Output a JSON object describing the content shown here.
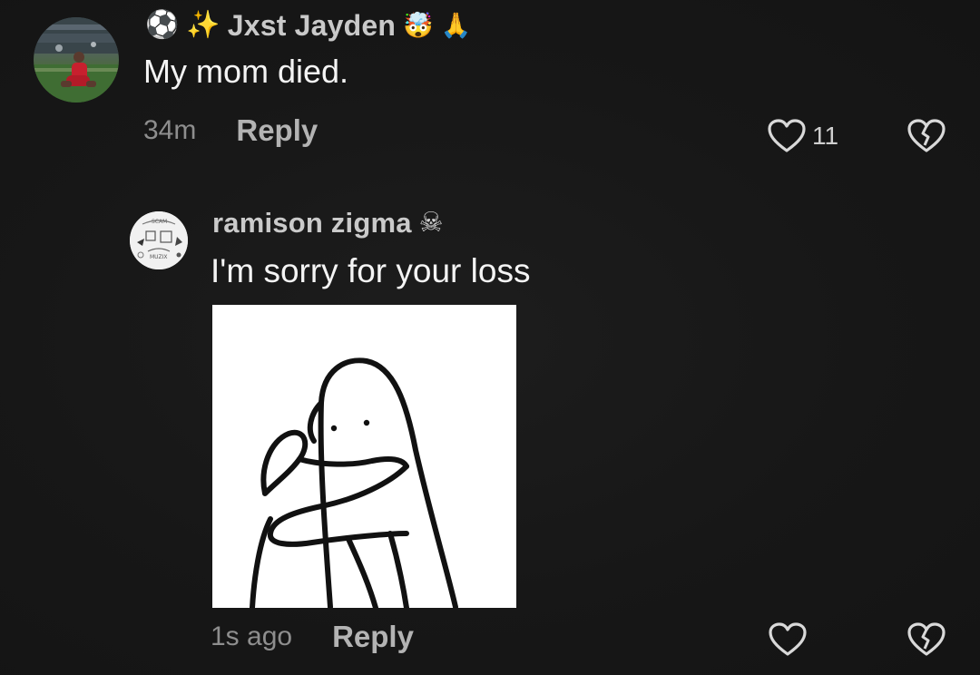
{
  "comments": [
    {
      "username": "Jxst Jayden",
      "name_prefix_emojis": [
        "soccer-ball",
        "dizzy-star"
      ],
      "name_suffix_emojis": [
        "exploding-head",
        "folded-hands"
      ],
      "text": "My mom died.",
      "time": "34m",
      "reply_label": "Reply",
      "like_count": "11",
      "avatar": "soccer-player-photo"
    },
    {
      "username": "ramison zigma",
      "name_suffix_emojis": [
        "skull-and-crossbones"
      ],
      "text": "I'm sorry for your loss",
      "time": "1s ago",
      "reply_label": "Reply",
      "like_count": "",
      "avatar": "sketch-doodle",
      "attachment": "sad-blob-hugging-sticker"
    }
  ],
  "colors": {
    "background": "#161616",
    "username": "#c9c9c9",
    "text": "#f4f4f4",
    "muted": "#8e8e8e",
    "reply": "#b3b3b3"
  }
}
